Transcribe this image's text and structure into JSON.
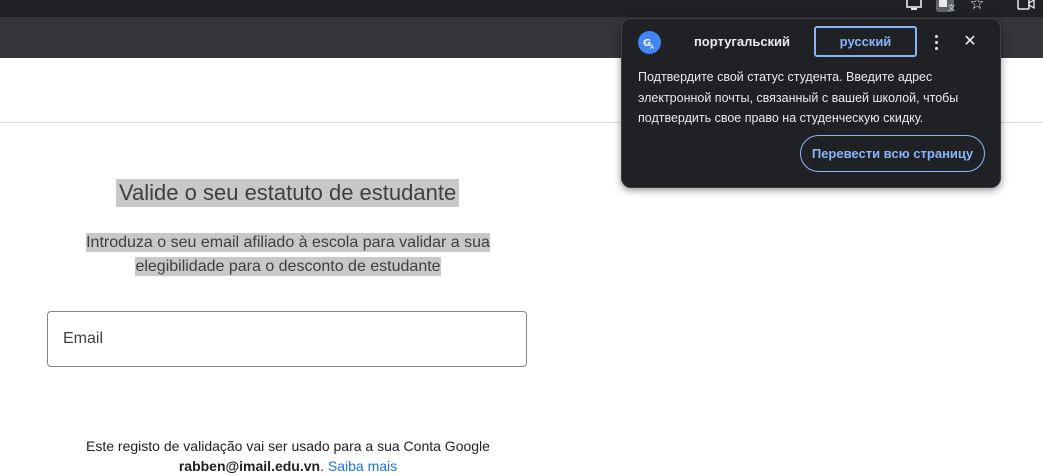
{
  "browser": {
    "icons": [
      "monitor-icon",
      "translate-icon",
      "star-icon",
      "video-icon"
    ]
  },
  "page": {
    "title": "Valide o seu estatuto de estudante",
    "subtitle_line1": "Introduza o seu email afiliado à escola para validar a sua",
    "subtitle_line2": "elegibilidade para o desconto de estudante",
    "email_placeholder": "Email",
    "footer_line1": "Este registo de validação vai ser usado para a sua Conta Google",
    "footer_email": "rabben@imail.edu.vn",
    "footer_separator": ".",
    "footer_link": "Saiba mais"
  },
  "translate_popup": {
    "source_language": "португальский",
    "target_language": "русский",
    "body": "Подтвердите свой статус студента. Введите адрес электронной почты, связанный с вашей школой, чтобы подтвердить свое право на студенческую скидку.",
    "translate_page_button": "Перевести всю страницу",
    "accent_color": "#8ab4f8",
    "background_color": "#202124"
  }
}
